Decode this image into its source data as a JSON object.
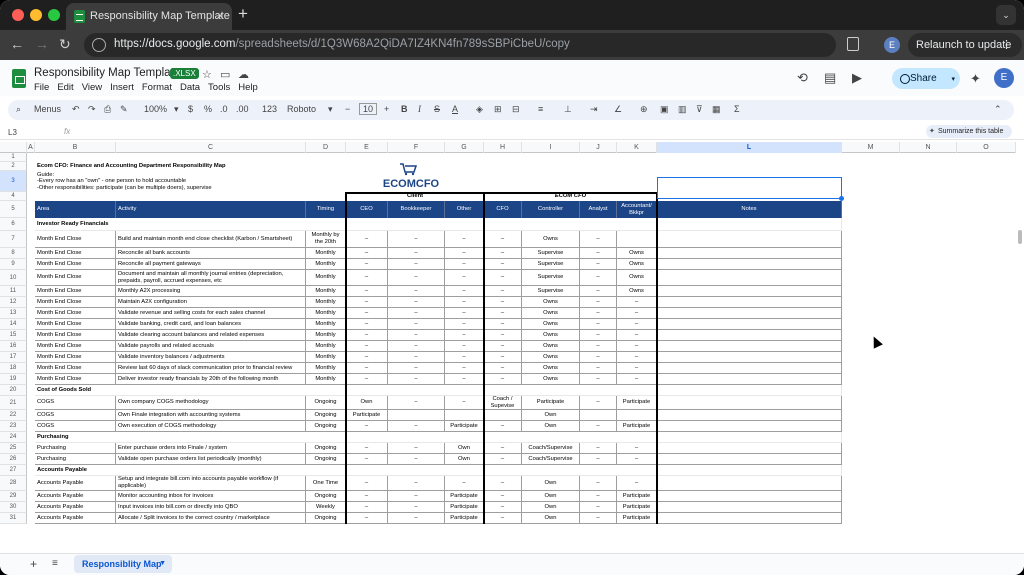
{
  "browser": {
    "tab_title": "Responsibility Map Template",
    "url_host": "https://docs.google.com",
    "url_path": "/spreadsheets/d/1Q3W68A2QiDA7IZ4KN4fn789sSBPiCbeU/copy",
    "relaunch_label": "Relaunch to update",
    "profile_initial": "E"
  },
  "doc": {
    "title": "Responsibility Map Template",
    "badge": ".XLSX",
    "menus": [
      "File",
      "Edit",
      "View",
      "Insert",
      "Format",
      "Data",
      "Tools",
      "Help"
    ],
    "share_label": "Share",
    "profile_initial": "E"
  },
  "toolbar": {
    "menus_label": "Menus",
    "zoom": "100%",
    "currency": "$",
    "percent": "%",
    "dec_dec": ".0",
    "dec_inc": ".00",
    "format_123": "123",
    "font": "Roboto",
    "font_size": "10"
  },
  "formula_bar": {
    "cell_ref": "L3",
    "fx": "fx",
    "summarize_label": "Summarize this table"
  },
  "sheet": {
    "col_letters": [
      "A",
      "B",
      "C",
      "D",
      "E",
      "F",
      "G",
      "H",
      "I",
      "J",
      "K",
      "L",
      "M",
      "N",
      "O"
    ],
    "row_numbers": [
      "1",
      "2",
      "3",
      "4",
      "5",
      "6",
      "7",
      "8",
      "9",
      "10",
      "11",
      "12",
      "13",
      "14",
      "15",
      "16",
      "17",
      "18",
      "19",
      "20",
      "21",
      "22",
      "23",
      "24",
      "25",
      "26",
      "27",
      "28",
      "29",
      "30",
      "31"
    ],
    "title_lines": [
      "Ecom CFO: Finance and Accounting Department Responsibility Map",
      "Guide:",
      "-Every row has an \"own\" - one person to hold accountable",
      "-Other responsibilities: participate (can be multiple doers), supervise"
    ],
    "logo_text": "ECOMCFO",
    "group_client": "Client",
    "group_ecom": "ECOM CFO",
    "headers": [
      "Area",
      "Activity",
      "Timing",
      "CEO",
      "Bookkeeper",
      "Other",
      "CFO",
      "Controller",
      "Analyst",
      "Accountant/ Bkkpr",
      "Notes"
    ],
    "rows": [
      {
        "n": "6",
        "section": "Investor Ready Financials"
      },
      {
        "n": "7",
        "c": [
          "Month End Close",
          "Build and maintain month end close checklist (Karbon / Smartsheet)",
          "Monthly by the 20th",
          "–",
          "–",
          "–",
          "–",
          "Owns",
          "–",
          ""
        ]
      },
      {
        "n": "8",
        "c": [
          "Month End Close",
          "Reconcile all bank accounts",
          "Monthly",
          "–",
          "–",
          "–",
          "–",
          "Supervise",
          "–",
          "Owns"
        ]
      },
      {
        "n": "9",
        "c": [
          "Month End Close",
          "Reconcile all payment gateways",
          "Monthly",
          "–",
          "–",
          "–",
          "–",
          "Supervise",
          "–",
          "Owns"
        ]
      },
      {
        "n": "10",
        "c": [
          "Month End Close",
          "Document and maintain all monthly journal entries (depreciation, prepaids, payroll, accrued expenses, etc",
          "Monthly",
          "–",
          "–",
          "–",
          "–",
          "Supervise",
          "–",
          "Owns"
        ]
      },
      {
        "n": "11",
        "c": [
          "Month End Close",
          "Monthly A2X processing",
          "Monthly",
          "–",
          "–",
          "–",
          "–",
          "Supervise",
          "–",
          "Owns"
        ]
      },
      {
        "n": "12",
        "c": [
          "Month End Close",
          "Maintain A2X configuration",
          "Monthly",
          "–",
          "–",
          "–",
          "–",
          "Owns",
          "–",
          "–"
        ]
      },
      {
        "n": "13",
        "c": [
          "Month End Close",
          "Validate revenue and selling costs for each sales channel",
          "Monthly",
          "–",
          "–",
          "–",
          "–",
          "Owns",
          "–",
          "–"
        ]
      },
      {
        "n": "14",
        "c": [
          "Month End Close",
          "Validate banking, credit card, and loan balances",
          "Monthly",
          "–",
          "–",
          "–",
          "–",
          "Owns",
          "–",
          "–"
        ]
      },
      {
        "n": "15",
        "c": [
          "Month End Close",
          "Validate clearing account balances and related expenses",
          "Monthly",
          "–",
          "–",
          "–",
          "–",
          "Owns",
          "–",
          "–"
        ]
      },
      {
        "n": "16",
        "c": [
          "Month End Close",
          "Validate payrolls and related accruals",
          "Monthly",
          "–",
          "–",
          "–",
          "–",
          "Owns",
          "–",
          "–"
        ]
      },
      {
        "n": "17",
        "c": [
          "Month End Close",
          "Validate inventory balances / adjustments",
          "Monthly",
          "–",
          "–",
          "–",
          "–",
          "Owns",
          "–",
          "–"
        ]
      },
      {
        "n": "18",
        "c": [
          "Month End Close",
          "Review last 60 days of slack communication prior to financial review",
          "Monthly",
          "–",
          "–",
          "–",
          "–",
          "Owns",
          "–",
          "–"
        ]
      },
      {
        "n": "19",
        "c": [
          "Month End Close",
          "Deliver investor ready financials by 20th of the following month",
          "Monthly",
          "–",
          "–",
          "–",
          "–",
          "Owns",
          "–",
          "–"
        ]
      },
      {
        "n": "20",
        "section": "Cost of Goods Sold"
      },
      {
        "n": "21",
        "c": [
          "COGS",
          "Own company COGS methodology",
          "Ongoing",
          "Own",
          "–",
          "–",
          "Coach / Supevise",
          "Participate",
          "–",
          "Participate"
        ]
      },
      {
        "n": "22",
        "c": [
          "COGS",
          "Own Finale integration with accounting systems",
          "Ongoing",
          "Participate",
          "",
          "",
          "",
          "Own",
          "",
          ""
        ]
      },
      {
        "n": "23",
        "c": [
          "COGS",
          "Own execution of COGS methodology",
          "Ongoing",
          "–",
          "–",
          "Participate",
          "–",
          "Own",
          "–",
          "Participate"
        ]
      },
      {
        "n": "24",
        "section": "Purchasing"
      },
      {
        "n": "25",
        "c": [
          "Purchasing",
          "Enter purchase orders into Finale / system",
          "Ongoing",
          "–",
          "–",
          "Own",
          "–",
          "Coach/Supervise",
          "–",
          "–"
        ]
      },
      {
        "n": "26",
        "c": [
          "Purchasing",
          "Validate open purchase orders list periodically (monthly)",
          "Ongoing",
          "–",
          "–",
          "Own",
          "–",
          "Coach/Supervise",
          "–",
          "–"
        ]
      },
      {
        "n": "27",
        "section": "Accounts Payable"
      },
      {
        "n": "28",
        "c": [
          "Accounts Payable",
          "Setup and integrate bill.com into accounts payable workflow (if applicable)",
          "One Time",
          "–",
          "–",
          "–",
          "–",
          "Own",
          "–",
          "–"
        ]
      },
      {
        "n": "29",
        "c": [
          "Accounts Payable",
          "Monitor accounting inbox for invoices",
          "Ongoing",
          "–",
          "–",
          "Participate",
          "–",
          "Own",
          "–",
          "Participate"
        ]
      },
      {
        "n": "30",
        "c": [
          "Accounts Payable",
          "Input invoices into bill.com or directly into QBO",
          "Weekly",
          "–",
          "–",
          "Participate",
          "–",
          "Own",
          "–",
          "Participate"
        ]
      },
      {
        "n": "31",
        "c": [
          "Accounts Payable",
          "Allocate / Split invoices to the correct country / marketplace",
          "Ongoing",
          "–",
          "–",
          "Participate",
          "–",
          "Own",
          "–",
          "Participate"
        ]
      }
    ]
  },
  "sheet_tabs": {
    "active": "Responsiblity Map"
  }
}
